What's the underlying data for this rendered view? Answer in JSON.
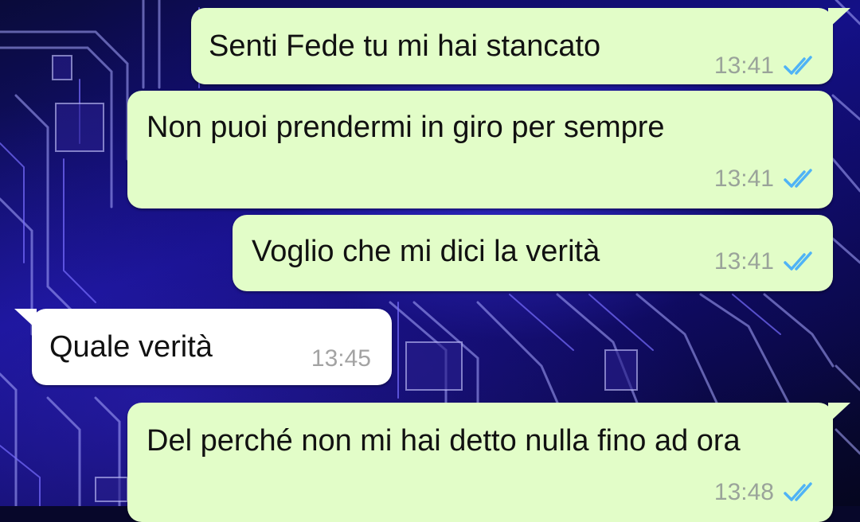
{
  "colors": {
    "outgoing_bubble": "#e2fdc8",
    "incoming_bubble": "#ffffff",
    "read_ticks": "#4fb3f6",
    "timestamp": "#9aa39a"
  },
  "messages": [
    {
      "direction": "outgoing",
      "text": "Senti Fede tu mi hai stancato",
      "time": "13:41",
      "status_icon": "double-check-read-icon"
    },
    {
      "direction": "outgoing",
      "text": "Non puoi prendermi in giro per sempre",
      "time": "13:41",
      "status_icon": "double-check-read-icon"
    },
    {
      "direction": "outgoing",
      "text": "Voglio che mi dici la verità",
      "time": "13:41",
      "status_icon": "double-check-read-icon"
    },
    {
      "direction": "incoming",
      "text": "Quale verità",
      "time": "13:45"
    },
    {
      "direction": "outgoing",
      "text": "Del perché non mi hai detto nulla fino ad ora",
      "time": "13:48",
      "status_icon": "double-check-read-icon"
    }
  ]
}
